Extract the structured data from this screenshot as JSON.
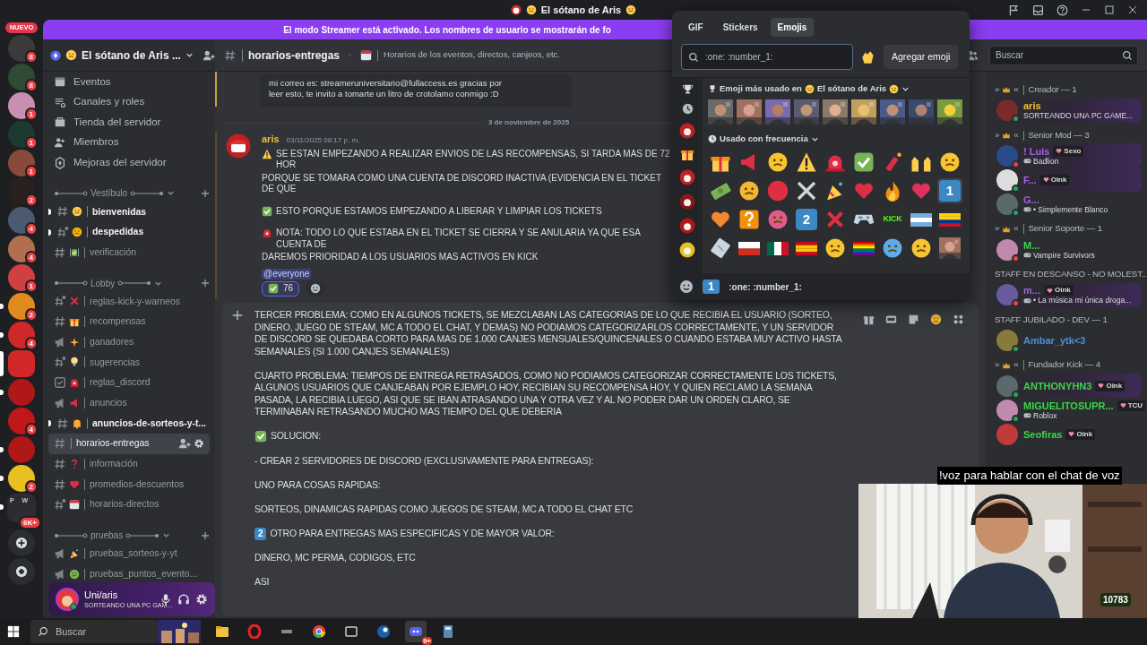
{
  "window": {
    "title": "El sótano de Aris"
  },
  "server_rail": {
    "new_label": "NUEVO",
    "servers": [
      {
        "badge": "8",
        "unread": false,
        "selected": false,
        "color": "#3a3a3a"
      },
      {
        "badge": "8",
        "unread": false,
        "selected": false,
        "color": "#2f4a35"
      },
      {
        "badge": "1",
        "unread": false,
        "selected": false,
        "color": "#c98fb0"
      },
      {
        "badge": "1",
        "unread": false,
        "selected": false,
        "color": "#1d3a30"
      },
      {
        "badge": "1",
        "unread": false,
        "selected": false,
        "color": "#8a4a3a"
      },
      {
        "badge": "2",
        "unread": false,
        "selected": false,
        "color": "#2a2020"
      },
      {
        "badge": "4",
        "unread": false,
        "selected": false,
        "color": "#4a5a70"
      },
      {
        "badge": "4",
        "unread": false,
        "selected": false,
        "color": "#b07050"
      },
      {
        "badge": "1",
        "unread": false,
        "selected": false,
        "color": "#d04040"
      },
      {
        "badge": "2",
        "unread": true,
        "selected": false,
        "color": "#e08a20"
      },
      {
        "badge": "4",
        "unread": true,
        "selected": false,
        "color": "#d02828"
      },
      {
        "unread": false,
        "selected": true,
        "color": "#d02828"
      },
      {
        "unread": true,
        "selected": false,
        "color": "#b01818"
      },
      {
        "badge": "4",
        "unread": false,
        "selected": false,
        "color": "#c01818"
      },
      {
        "unread": true,
        "selected": false,
        "color": "#b01818"
      },
      {
        "badge": "2",
        "unread": true,
        "selected": false,
        "color": "#e8c020"
      }
    ],
    "folder": {
      "labels": [
        "P",
        "W"
      ],
      "badge": "6K+",
      "unread": true
    }
  },
  "banner": {
    "text": "El modo Streamer está activado. Los nombres de usuario se mostrarán de fo"
  },
  "server": {
    "name": "El sótano de Aris ..."
  },
  "server_menu": [
    {
      "label": "Eventos"
    },
    {
      "label": "Canales y roles"
    },
    {
      "label": "Tienda del servidor"
    },
    {
      "label": "Miembros"
    },
    {
      "label": "Mejoras del servidor"
    }
  ],
  "categories": [
    {
      "name": "Vestíbulo",
      "channels": [
        {
          "name": "bienvenidas",
          "kind": "text",
          "unread": true,
          "selected": false
        },
        {
          "name": "despedidas",
          "kind": "thread",
          "unread": true,
          "selected": false
        },
        {
          "name": "verificación",
          "kind": "text",
          "unread": false,
          "selected": false
        }
      ]
    },
    {
      "name": "Lobby",
      "channels": [
        {
          "name": "reglas-kick-y-warneos",
          "kind": "thread",
          "unread": false,
          "selected": false
        },
        {
          "name": "recompensas",
          "kind": "text",
          "unread": false,
          "selected": false
        },
        {
          "name": "ganadores",
          "kind": "announce",
          "unread": false,
          "selected": false
        },
        {
          "name": "sugerencias",
          "kind": "thread",
          "unread": false,
          "selected": false
        },
        {
          "name": "reglas_discord",
          "kind": "rules",
          "unread": false,
          "selected": false
        },
        {
          "name": "anuncios",
          "kind": "announce",
          "unread": false,
          "selected": false
        },
        {
          "name": "anuncios-de-sorteos-y-t...",
          "kind": "text",
          "unread": true,
          "selected": false
        },
        {
          "name": "horarios-entregas",
          "kind": "text",
          "unread": false,
          "selected": true
        },
        {
          "name": "información",
          "kind": "text",
          "unread": false,
          "selected": false
        },
        {
          "name": "promedios-descuentos",
          "kind": "text",
          "unread": false,
          "selected": false
        },
        {
          "name": "horarios-directos",
          "kind": "thread",
          "unread": false,
          "selected": false
        }
      ]
    },
    {
      "name": "pruebas",
      "channels": [
        {
          "name": "pruebas_sorteos-y-yt",
          "kind": "announce",
          "unread": false,
          "selected": false
        },
        {
          "name": "pruebas_puntos_evento...",
          "kind": "announce",
          "unread": false,
          "selected": false
        }
      ]
    }
  ],
  "user_panel": {
    "name": "Uni/aris",
    "status": "SORTEANDO UNA PC GAM..."
  },
  "channel_header": {
    "name": "horarios-entregas",
    "topic": "Horarios de los eventos, directos, canjeos, etc."
  },
  "search": {
    "placeholder": "Buscar"
  },
  "embed_lines": [
    "mi correo es: streameruniversitario@fullaccess.es gracias por",
    "leer esto, te invito a tomarte un litro de crotolamo conmigo :D"
  ],
  "date_divider": "3 de noviembre de 2025",
  "message": {
    "author": "aris",
    "time": "03/11/2025 08:17 p. m.",
    "lines": [
      {
        "kind": "warning",
        "text": "SE ESTAN EMPEZANDO A REALIZAR ENVIOS DE LAS RECOMPENSAS, SI TARDA MAS DE 72 HOR"
      },
      {
        "kind": "plain",
        "text": "PORQUE SE TOMARA COMO UNA CUENTA DE DISCORD INACTIVA (EVIDENCIA EN EL TICKET DE QUE"
      },
      {
        "kind": "check",
        "text": "ESTO PORQUE ESTAMOS EMPEZANDO A LIBERAR Y LIMPIAR LOS TICKETS"
      },
      {
        "kind": "siren",
        "text": "NOTA: TODO LO QUE ESTABA EN EL TICKET SE CIERRA Y SE ANULARIA YA QUE ESA CUENTA DE"
      },
      {
        "kind": "plain",
        "text": "DAREMOS PRIORIDAD A LOS USUARIOS MAS ACTIVOS EN KICK"
      }
    ],
    "mention": "@everyone",
    "reaction": {
      "count": "76",
      "selected": true
    }
  },
  "composer": {
    "paragraphs": [
      {
        "kind": "plain",
        "text": "TERCER PROBLEMA: COMO EN ALGUNOS TICKETS, SE MEZCLABAN LAS CATEGORIAS DE LO QUE RECIBIA EL USUARIO (SORTEO, DINERO, JUEGO DE STEAM, MC A TODO EL CHAT, Y DEMAS) NO PODIAMOS CATEGORIZARLOS CORRECTAMENTE, Y UN SERVIDOR DE DISCORD SE QUEDABA CORTO PARA MAS DE 1.000 CANJES MENSUALES/QUINCENALES O CUANDO ESTABA MUY ACTIVO HASTA SEMANALES (SI 1.000 CANJES SEMANALES)"
      },
      {
        "kind": "plain",
        "text": "CUARTO PROBLEMA: TIEMPOS DE ENTREGA RETRASADOS, COMO NO PODIAMOS CATEGORIZAR CORRECTAMENTE LOS TICKETS, ALGUNOS USUARIOS QUE CANJEABAN POR EJEMPLO HOY, RECIBIAN SU RECOMPENSA HOY, Y QUIEN RECLAMO LA SEMANA PASADA, LA RECIBIA LUEGO, ASI QUE SE IBAN ATRASANDO UNA Y OTRA VEZ Y AL NO PODER DAR UN ORDEN CLARO, SE TERMINABAN RETRASANDO MUCHO MAS TIEMPO DEL QUE DEBERIA"
      },
      {
        "kind": "check",
        "text": "SOLUCION:"
      },
      {
        "kind": "plain",
        "text": "- CREAR 2 SERVIDORES DE DISCORD (EXCLUSIVAMENTE PARA ENTREGAS):"
      },
      {
        "kind": "plain",
        "text": "UNO PARA COSAS RAPIDAS:"
      },
      {
        "kind": "plain",
        "text": "SORTEOS, DINAMICAS RAPIDAS COMO JUEGOS DE STEAM, MC A TODO EL CHAT ETC"
      },
      {
        "kind": "keycap",
        "keycap": "2",
        "text": "OTRO PARA ENTREGAS MAS ESPECIFICAS Y DE MAYOR VALOR:"
      },
      {
        "kind": "plain",
        "text": "DINERO, MC PERMA, CODIGOS, ETC"
      },
      {
        "kind": "plain",
        "text": "ASI"
      }
    ]
  },
  "emoji_picker": {
    "tabs": [
      {
        "label": "GIF",
        "selected": false
      },
      {
        "label": "Stickers",
        "selected": false
      },
      {
        "label": "Emojis",
        "selected": true
      }
    ],
    "search": {
      "placeholder": ":one: :number_1:"
    },
    "add_button": "Agregar emoji",
    "server_section": {
      "prefix": "Emoji más usado en",
      "server": "El sótano de Aris"
    },
    "server_emoji": [
      {
        "kind": "picture"
      },
      {
        "kind": "picture"
      },
      {
        "kind": "picture"
      },
      {
        "kind": "picture"
      },
      {
        "kind": "picture"
      },
      {
        "kind": "picture"
      },
      {
        "kind": "picture"
      },
      {
        "kind": "picture"
      },
      {
        "kind": "picture"
      }
    ],
    "frequent_section": "Usado con frecuencia",
    "frequent": [
      {
        "kind": "gift",
        "hovered": false
      },
      {
        "kind": "megaphone",
        "hovered": false
      },
      {
        "kind": "face_party",
        "hovered": false
      },
      {
        "kind": "warning",
        "hovered": false
      },
      {
        "kind": "siren",
        "hovered": false
      },
      {
        "kind": "check",
        "hovered": false
      },
      {
        "kind": "firecracker",
        "hovered": false
      },
      {
        "kind": "hands",
        "hovered": false
      },
      {
        "kind": "face_stars",
        "hovered": false
      },
      {
        "kind": "money",
        "hovered": false
      },
      {
        "kind": "face_shock",
        "hovered": false
      },
      {
        "kind": "circle",
        "hovered": false
      },
      {
        "kind": "swords",
        "hovered": false
      },
      {
        "kind": "popper",
        "hovered": false
      },
      {
        "kind": "heart",
        "hovered": false
      },
      {
        "kind": "fire",
        "hovered": false
      },
      {
        "kind": "heart_sparkle",
        "hovered": false
      },
      {
        "kind": "keycap",
        "text": "1",
        "hovered": true
      },
      {
        "kind": "heart_ribbon",
        "hovered": false
      },
      {
        "kind": "question",
        "hovered": false
      },
      {
        "kind": "face_devil",
        "hovered": false
      },
      {
        "kind": "keycap",
        "text": "2",
        "hovered": false
      },
      {
        "kind": "cross",
        "hovered": false
      },
      {
        "kind": "gamepad",
        "hovered": false
      },
      {
        "kind": "logo",
        "text": "KICK",
        "hovered": false
      },
      {
        "kind": "flag_ar",
        "hovered": false
      },
      {
        "kind": "flag_co",
        "hovered": false
      },
      {
        "kind": "ticket",
        "hovered": false
      },
      {
        "kind": "flag_cl",
        "hovered": false
      },
      {
        "kind": "flag_mx",
        "hovered": false
      },
      {
        "kind": "flag_es",
        "hovered": false
      },
      {
        "kind": "face_cry",
        "hovered": false
      },
      {
        "kind": "flag_rainbow",
        "hovered": false
      },
      {
        "kind": "face_cold",
        "hovered": false
      },
      {
        "kind": "face_laugh",
        "hovered": false
      },
      {
        "kind": "picture",
        "hovered": false
      }
    ],
    "preview": {
      "keycap": "1",
      "text": ":one: :number_1:"
    }
  },
  "members": {
    "groups": [
      {
        "prefix": "»",
        "suffix": "«",
        "label": "Creador — 1",
        "members": [
          {
            "name": "aris",
            "color": "#f0c030",
            "activity": "SORTEANDO UNA PC GAME...",
            "busy": false,
            "banner": true
          }
        ]
      },
      {
        "prefix": "»",
        "suffix": "«",
        "label": "Senior Mod — 3",
        "members": [
          {
            "name": "! Luis",
            "color": "#a066d8",
            "tag": "Sexo",
            "activity": "Badlion",
            "busy": true,
            "banner": true
          },
          {
            "name": "F...",
            "color": "#a066d8",
            "tag": "Oink",
            "busy": false,
            "banner": true
          },
          {
            "name": "G...",
            "color": "#a066d8",
            "activity": "• Simplemente Blanco",
            "busy": false,
            "banner": false
          }
        ]
      },
      {
        "prefix": "»",
        "suffix": "«",
        "label": "Senior Soporte — 1",
        "members": [
          {
            "name": "M...",
            "color": "#3ad44a",
            "activity": "Vampire Survivors",
            "busy": true,
            "banner": false
          }
        ]
      },
      {
        "label": "STAFF EN DESCANSO - NO MOLEST...",
        "members": [
          {
            "name": "m...",
            "color": "#a066d8",
            "tag": "Oink",
            "activity": "• La música mi única droga...",
            "busy": true,
            "banner": true
          }
        ]
      },
      {
        "label": "STAFF JUBILADO - DEV — 1",
        "members": [
          {
            "name": "Ambar_ytk<3",
            "color": "#4a90d9",
            "busy": false,
            "banner": false
          }
        ]
      },
      {
        "prefix": "»",
        "suffix": "«",
        "label": "Fundador Kick — 4",
        "members": [
          {
            "name": "ANTHONYHN3",
            "color": "#3ad44a",
            "tag": "Oink",
            "busy": false,
            "banner": true
          },
          {
            "name": "MIGUELITOSUPR...",
            "color": "#3ad44a",
            "tag": "TCU",
            "activity": "Roblox",
            "busy": false,
            "banner": false
          },
          {
            "name": "Seofiras",
            "color": "#3ad44a",
            "tag": "Oink",
            "banner": false
          }
        ]
      }
    ]
  },
  "stream_overlay": {
    "caption": "!voz para hablar con el chat de voz",
    "counter": "10783"
  },
  "taskbar": {
    "search_placeholder": "Buscar",
    "discord_badge": "9+"
  }
}
